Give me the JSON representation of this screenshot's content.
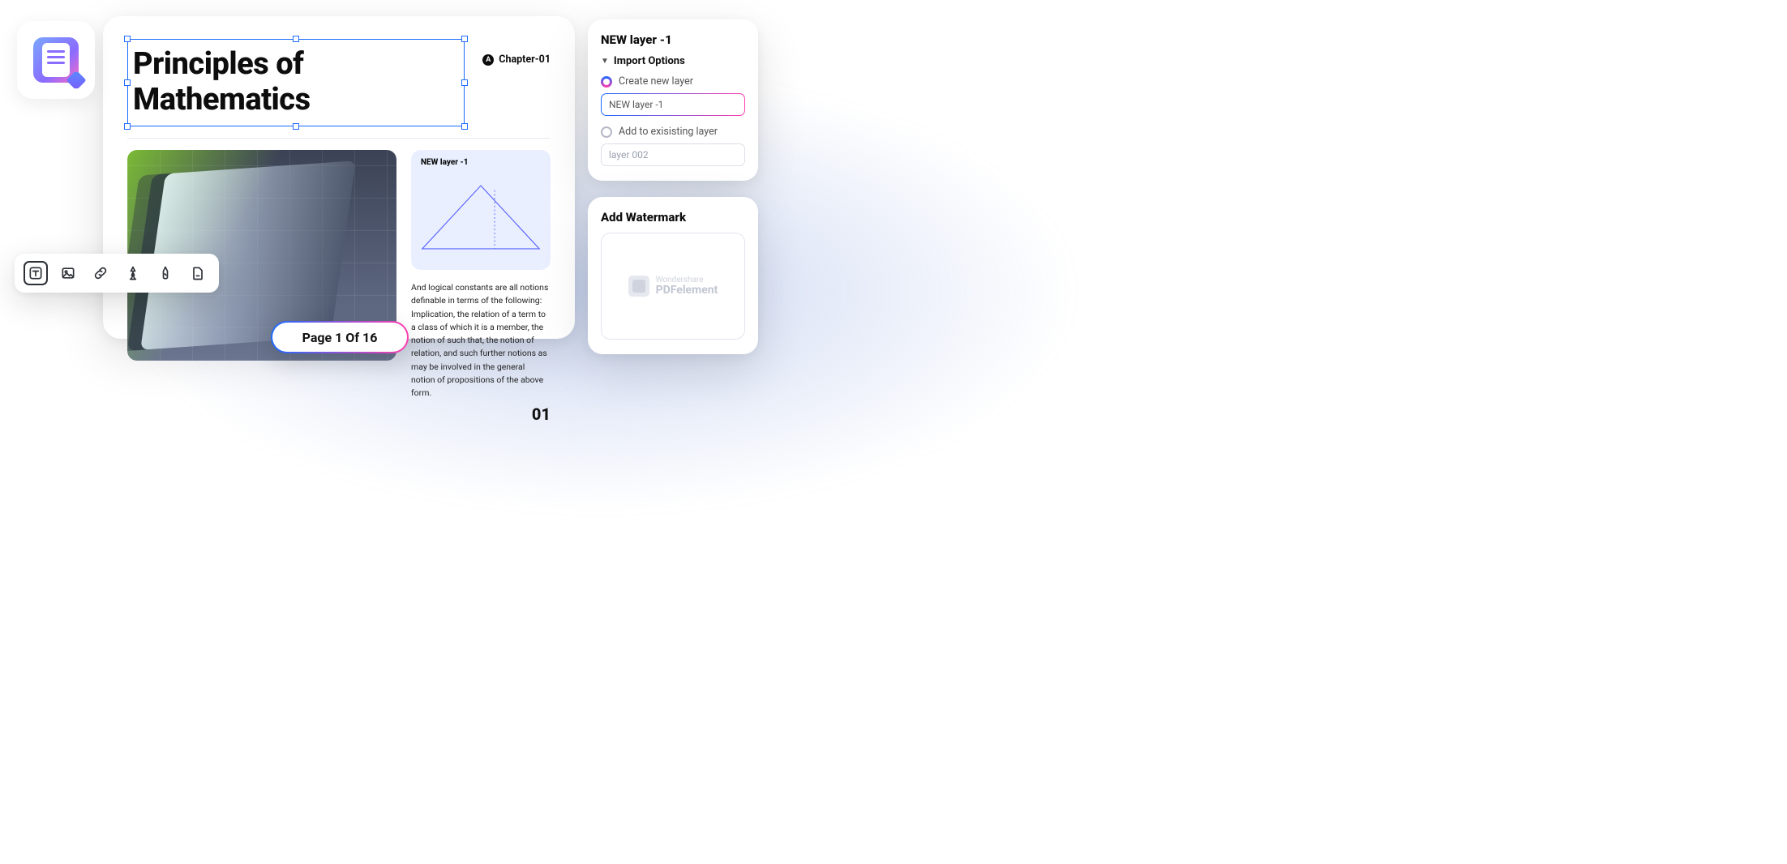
{
  "logo": {
    "alt": "PDF editor app icon"
  },
  "document": {
    "title": "Principles of Mathematics",
    "chapter_label": "Chapter-01",
    "chapter_badge_letter": "A",
    "image_alt": "abstract 3D glossy object on grid",
    "triangle_card_label": "NEW layer -1",
    "body_text": "And logical constants are all notions definable in terms of the following: Implication, the relation of a term to a class of which it is a member, the notion of such that, the notion of relation, and such further notions as may be involved in the general notion of propositions of the above form.",
    "page_number": "01"
  },
  "page_indicator": "Page 1 Of 16",
  "toolbar": {
    "items": [
      {
        "name": "text-tool-icon",
        "active": true
      },
      {
        "name": "image-tool-icon",
        "active": false
      },
      {
        "name": "link-tool-icon",
        "active": false
      },
      {
        "name": "font-tool-icon",
        "active": false
      },
      {
        "name": "edit-shape-icon",
        "active": false
      },
      {
        "name": "page-tool-icon",
        "active": false
      }
    ]
  },
  "layer_panel": {
    "title": "NEW layer -1",
    "section_label": "Import Options",
    "option_create_label": "Create new layer",
    "option_create_value": "NEW layer -1",
    "option_add_label": "Add to exisisting layer",
    "option_add_value": "layer 002"
  },
  "watermark_panel": {
    "title": "Add Watermark",
    "brand_line1": "Wondershare",
    "brand_line2": "PDFelement"
  }
}
